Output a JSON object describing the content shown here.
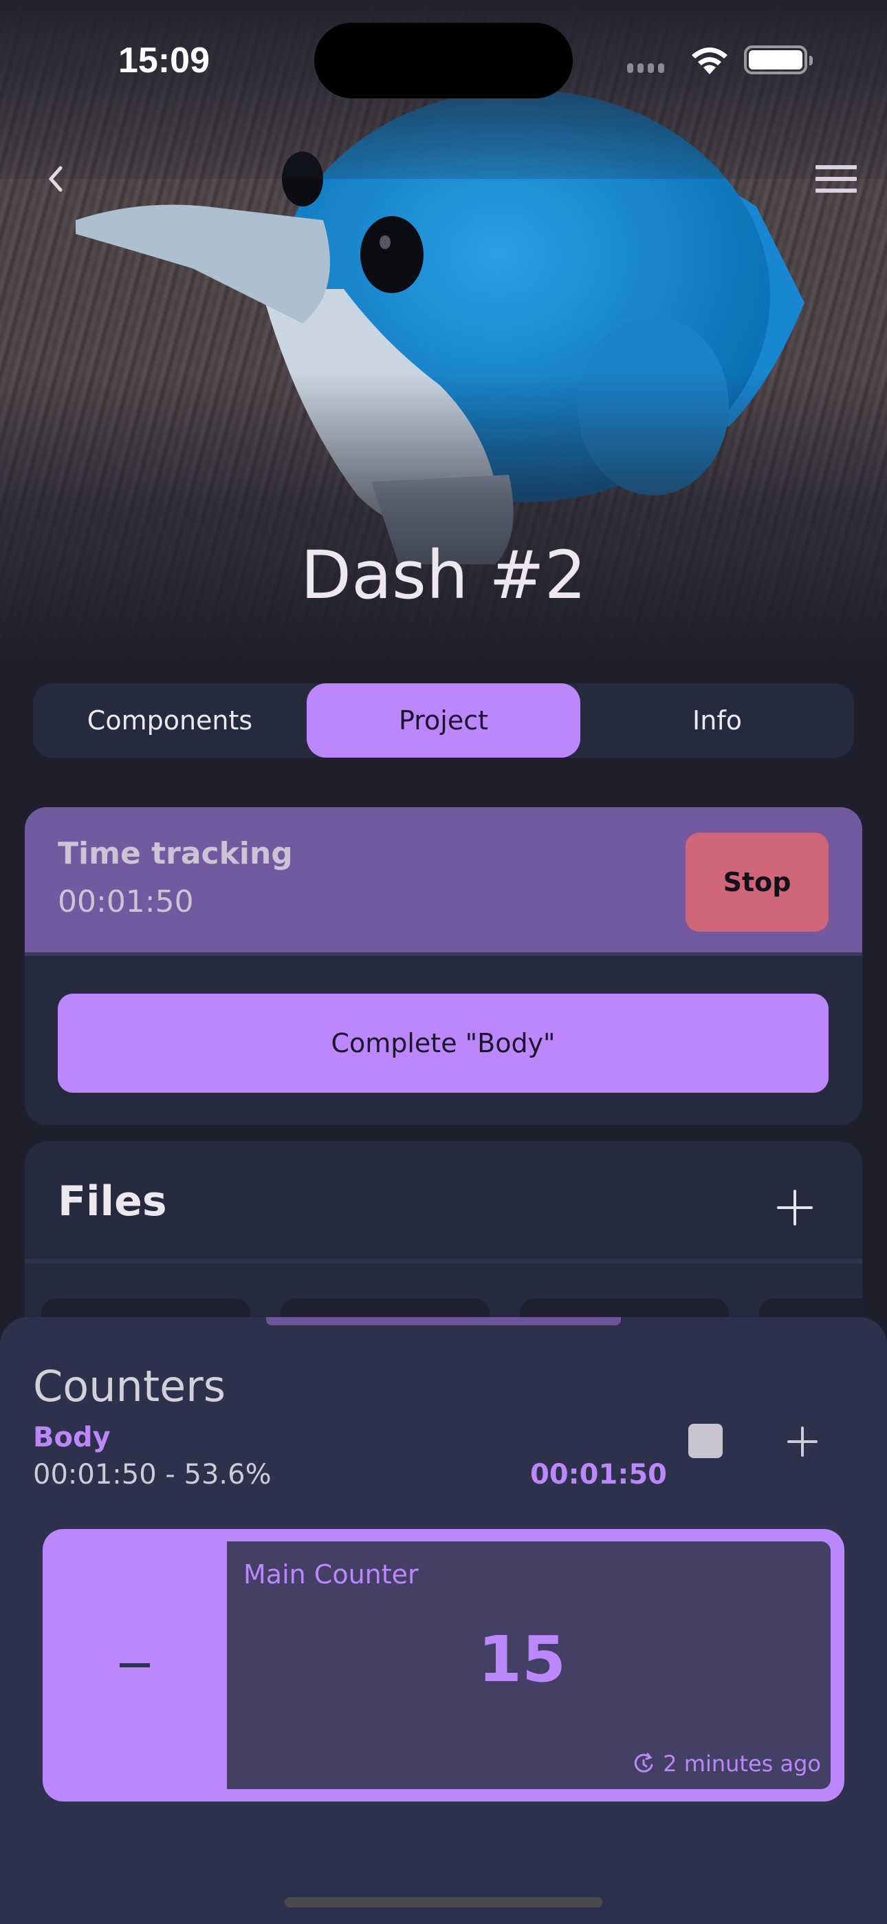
{
  "status_bar": {
    "time": "15:09"
  },
  "header": {
    "back_icon": "chevron-left-icon",
    "menu_icon": "hamburger-menu-icon",
    "title": "Dash #2"
  },
  "tabs": [
    {
      "label": "Components",
      "active": false
    },
    {
      "label": "Project",
      "active": true
    },
    {
      "label": "Info",
      "active": false
    }
  ],
  "time_tracking": {
    "title": "Time tracking",
    "elapsed": "00:01:50",
    "stop_label": "Stop",
    "complete_label": "Complete \"Body\""
  },
  "files": {
    "title": "Files",
    "add_icon": "plus-icon"
  },
  "counters": {
    "title": "Counters",
    "section": {
      "name": "Body",
      "summary": "00:01:50 - 53.6%",
      "timer": "00:01:50"
    },
    "items": [
      {
        "name": "Main Counter",
        "value": "15",
        "updated": "2 minutes ago",
        "decrement_label": "–"
      }
    ]
  },
  "colors": {
    "accent": "#bc87fb",
    "tracking_bg": "#7259a0",
    "stop": "#d06678",
    "card_bg": "#262a3f",
    "sheet_bg": "#2d314b",
    "page_bg": "#1f1f2e"
  }
}
